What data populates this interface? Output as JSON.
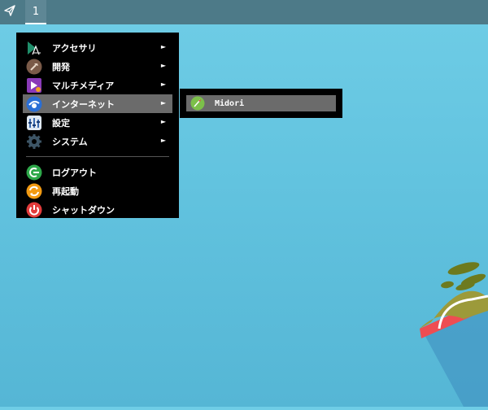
{
  "panel": {
    "workspace_label": "1"
  },
  "menu": {
    "items": [
      {
        "label": "アクセサリ",
        "icon": "accessories-icon",
        "has_submenu": true
      },
      {
        "label": "開発",
        "icon": "development-icon",
        "has_submenu": true
      },
      {
        "label": "マルチメディア",
        "icon": "multimedia-icon",
        "has_submenu": true
      },
      {
        "label": "インターネット",
        "icon": "internet-icon",
        "has_submenu": true,
        "active": true
      },
      {
        "label": "設定",
        "icon": "settings-icon",
        "has_submenu": true
      },
      {
        "label": "システム",
        "icon": "system-icon",
        "has_submenu": true
      }
    ],
    "session": [
      {
        "label": "ログアウト",
        "icon": "logout-icon"
      },
      {
        "label": "再起動",
        "icon": "restart-icon"
      },
      {
        "label": "シャットダウン",
        "icon": "shutdown-icon"
      }
    ],
    "arrow_glyph": "►"
  },
  "submenu": {
    "items": [
      {
        "label": "Midori",
        "icon": "midori-icon"
      }
    ]
  },
  "colors": {
    "panel": "#4d7a88",
    "menu_bg": "#000000",
    "highlight": "#6b6b6b",
    "desktop": "#62c3df"
  }
}
